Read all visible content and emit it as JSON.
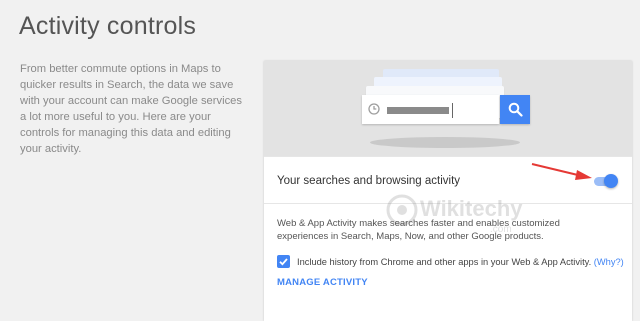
{
  "page": {
    "title": "Activity controls",
    "intro": "From better commute options in Maps to quicker results in Search, the data we save with your account can make Google services a lot more useful to you. Here are your controls for managing this data and editing your activity."
  },
  "card": {
    "illustration": {
      "icons": [
        "clock-icon",
        "search-icon"
      ]
    },
    "setting_title": "Your searches and browsing activity",
    "toggle_on": true,
    "description": "Web & App Activity makes searches faster and enables customized experiences in Search, Maps, Now, and other Google products.",
    "checkbox": {
      "checked": true,
      "label": "Include history from Chrome and other apps in your Web & App Activity.",
      "link": "(Why?)"
    },
    "manage_link": "MANAGE ACTIVITY"
  },
  "watermark": {
    "text": "Wikitechy",
    "subtext": ".com"
  },
  "colors": {
    "accent": "#4285f4",
    "arrow": "#e53935",
    "background": "#f1f1f1"
  }
}
